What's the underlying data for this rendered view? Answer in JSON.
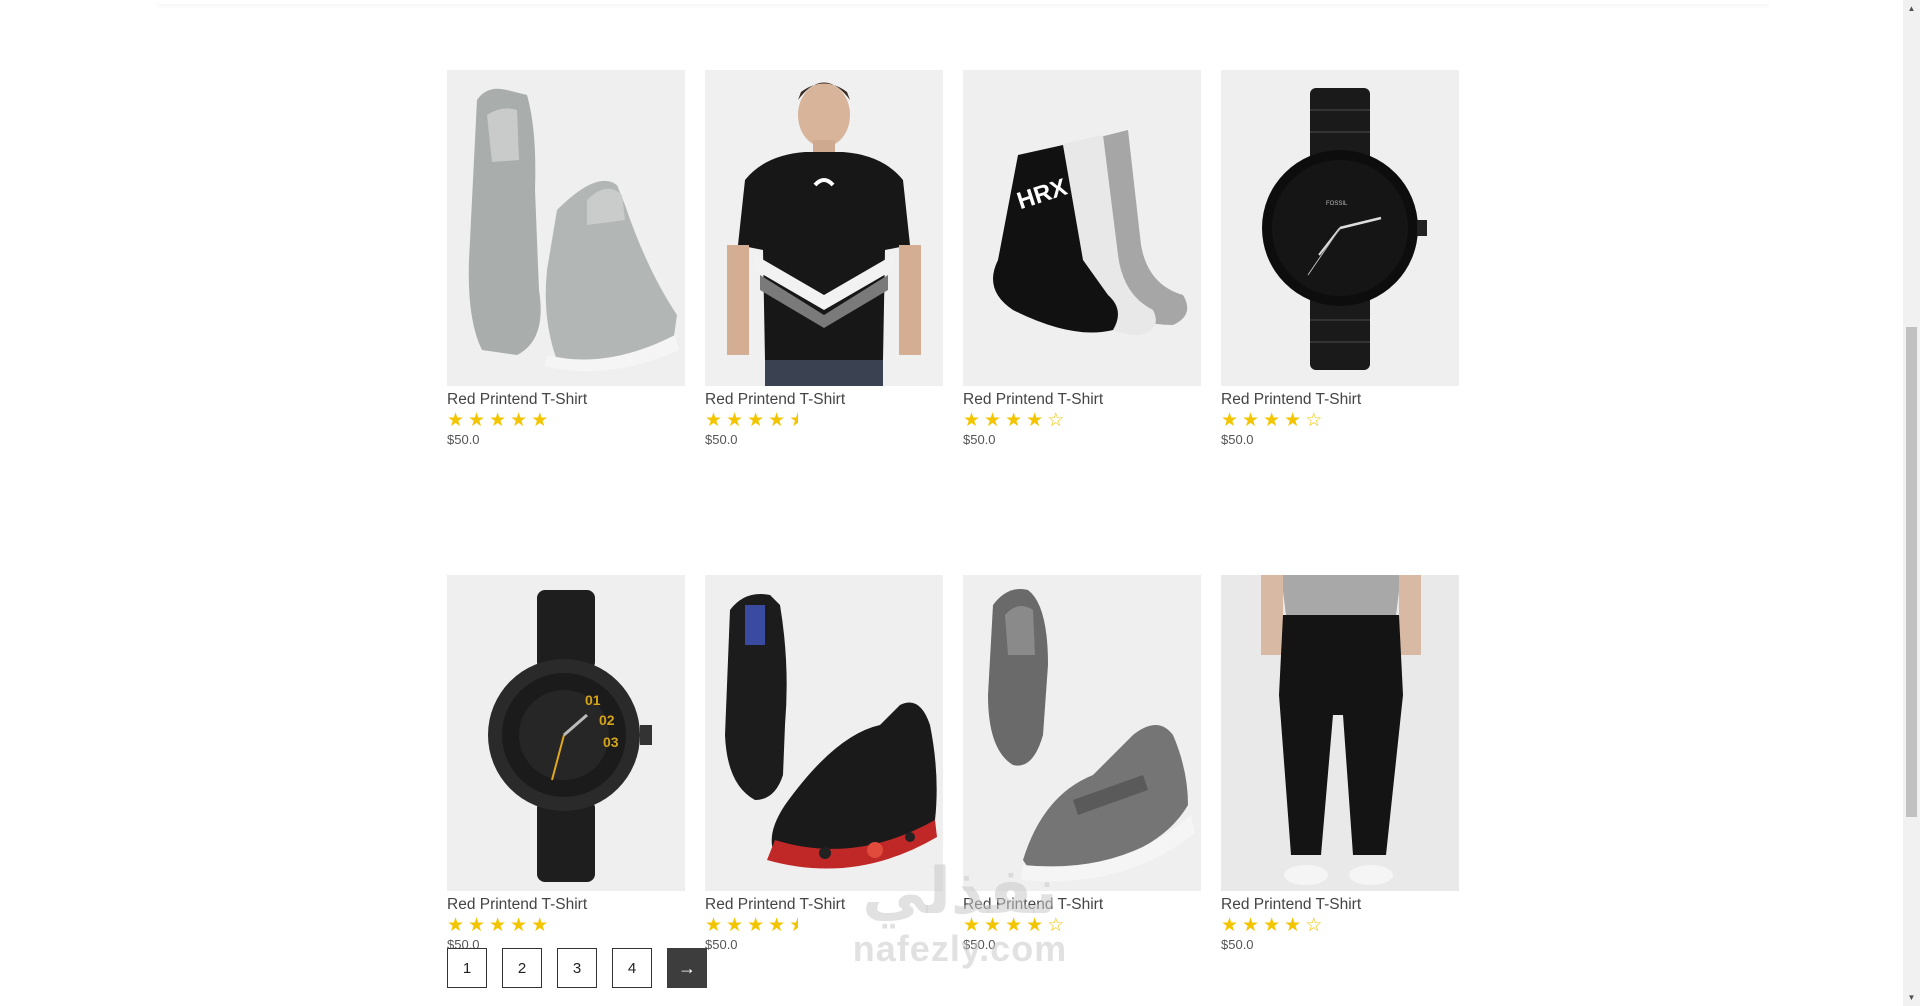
{
  "products": [
    {
      "title": "Red Printend T-Shirt",
      "price": "$50.0",
      "rating": 5,
      "image": "grey-high-top-sneakers"
    },
    {
      "title": "Red Printend T-Shirt",
      "price": "$50.0",
      "rating": 4.5,
      "image": "black-puma-tshirt"
    },
    {
      "title": "Red Printend T-Shirt",
      "price": "$50.0",
      "rating": 4,
      "image": "hrx-socks"
    },
    {
      "title": "Red Printend T-Shirt",
      "price": "$50.0",
      "rating": 4,
      "image": "black-fossil-watch"
    },
    {
      "title": "Red Printend T-Shirt",
      "price": "$50.0",
      "rating": 5,
      "image": "black-roadster-watch"
    },
    {
      "title": "Red Printend T-Shirt",
      "price": "$50.0",
      "rating": 4.5,
      "image": "black-red-running-shoes"
    },
    {
      "title": "Red Printend T-Shirt",
      "price": "$50.0",
      "rating": 4,
      "image": "grey-slip-on-shoes"
    },
    {
      "title": "Red Printend T-Shirt",
      "price": "$50.0",
      "rating": 4,
      "image": "black-joggers"
    }
  ],
  "pagination": {
    "pages": [
      "1",
      "2",
      "3",
      "4"
    ],
    "next_label": "→"
  },
  "watermark": {
    "arabic": "نفذلي",
    "latin": "nafezly.com"
  },
  "colors": {
    "star": "#f3c400",
    "thumb_bg": "#efefef",
    "next_button": "#3d3d3d"
  }
}
